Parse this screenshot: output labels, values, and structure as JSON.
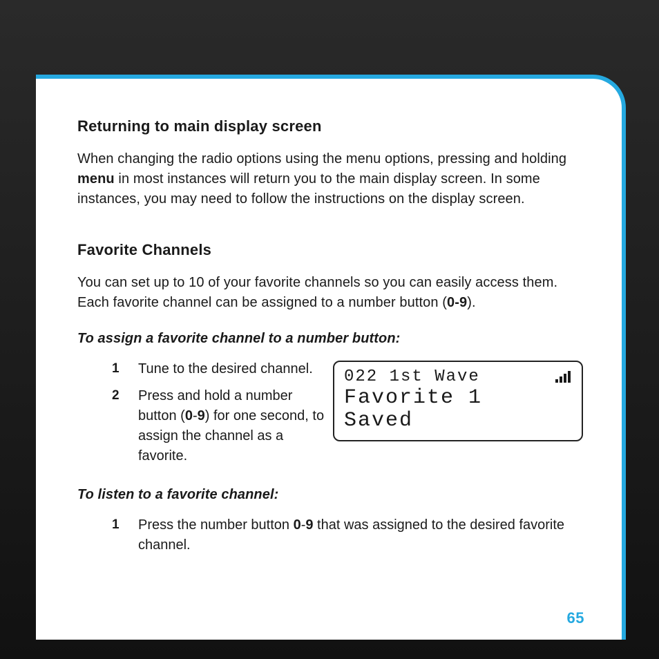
{
  "section1": {
    "heading": "Returning to main display screen",
    "body_before": "When changing the radio options using the menu options, pressing and holding ",
    "body_bold": "menu",
    "body_after": " in most instances will return you to the main display screen. In some instances, you may need to follow the instructions on the display screen."
  },
  "section2": {
    "heading": "Favorite Channels",
    "body_before": "You can set up to 10 of your favorite channels so you can easily access them. Each favorite channel can be assigned to a number button (",
    "body_bold": "0-9",
    "body_after": ")."
  },
  "assign": {
    "lead": "To assign a favorite channel to a number button:",
    "step1": "Tune to the desired channel.",
    "step2_before": "Press and hold a number button (",
    "step2_bold": "0",
    "step2_mid": "-",
    "step2_bold2": "9",
    "step2_after": ") for one second, to assign the channel as a favorite."
  },
  "listen": {
    "lead": "To listen to a favorite channel:",
    "step1_before": "Press the number button ",
    "step1_bold": "0",
    "step1_mid": "-",
    "step1_bold2": "9",
    "step1_after": " that was assigned to the desired favorite channel."
  },
  "device": {
    "line1": "022 1st Wave",
    "line2": "Favorite 1",
    "line3": "Saved"
  },
  "page_number": "65"
}
